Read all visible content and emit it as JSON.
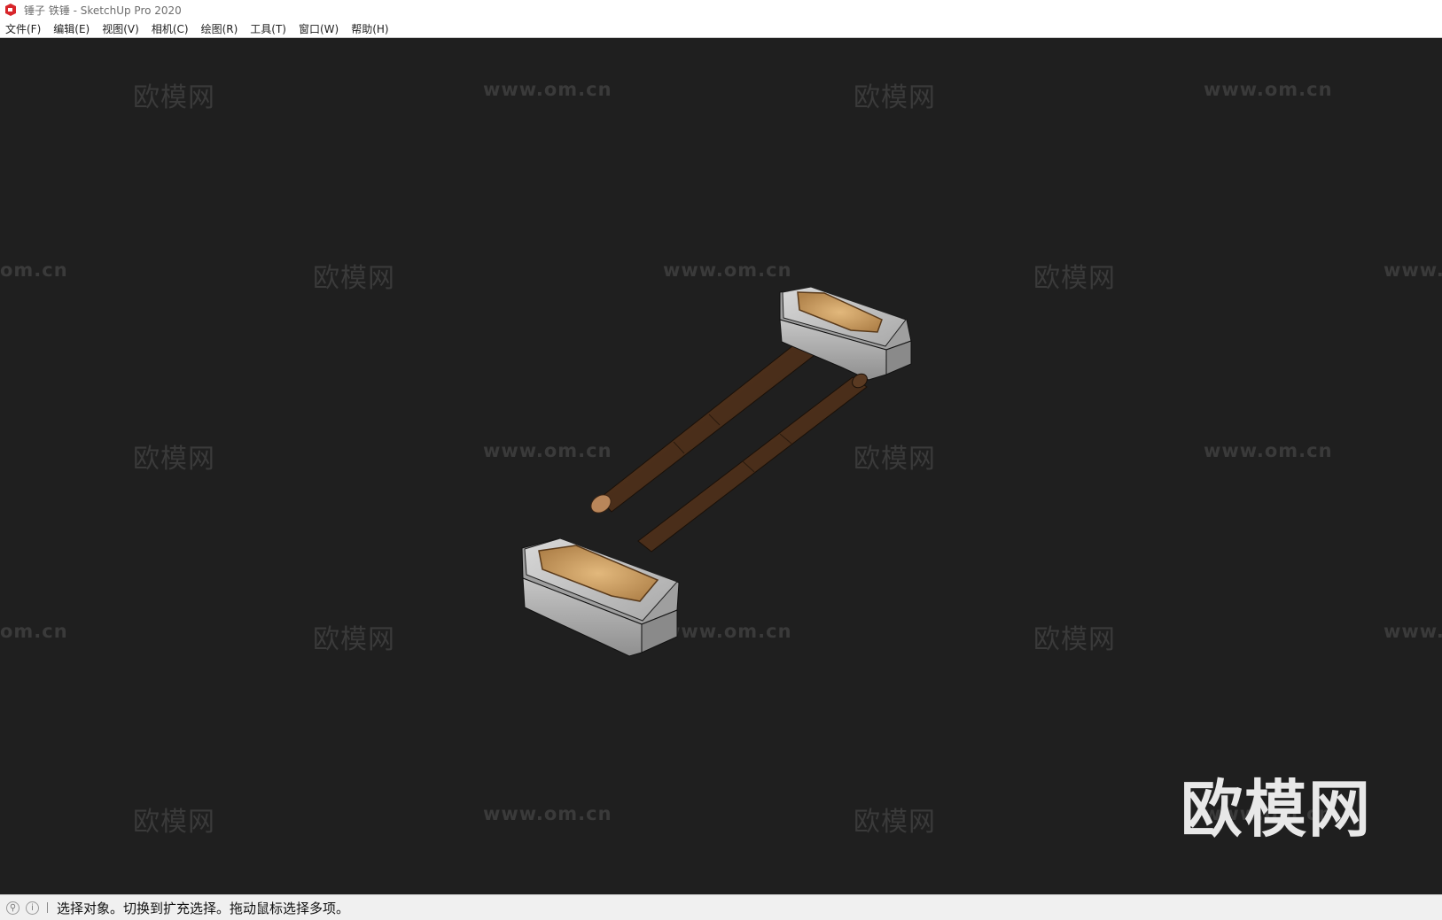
{
  "window": {
    "title": "锤子 铁锤 - SketchUp Pro 2020",
    "app_icon": "sketchup-logo-icon"
  },
  "menu": [
    {
      "label": "文件(F)"
    },
    {
      "label": "编辑(E)"
    },
    {
      "label": "视图(V)"
    },
    {
      "label": "相机(C)"
    },
    {
      "label": "绘图(R)"
    },
    {
      "label": "工具(T)"
    },
    {
      "label": "窗口(W)"
    },
    {
      "label": "帮助(H)"
    }
  ],
  "viewport": {
    "background": "#1f1f1f",
    "watermark_cn": "欧模网",
    "watermark_url": "www.om.cn",
    "watermark_url_left_partial": "om.cn",
    "watermark_url_right_partial": "www.",
    "brand_logo_text": "欧模网"
  },
  "status": {
    "icons": [
      "geo-location-icon",
      "info-icon"
    ],
    "message": "选择对象。切换到扩充选择。拖动鼠标选择多项。"
  }
}
